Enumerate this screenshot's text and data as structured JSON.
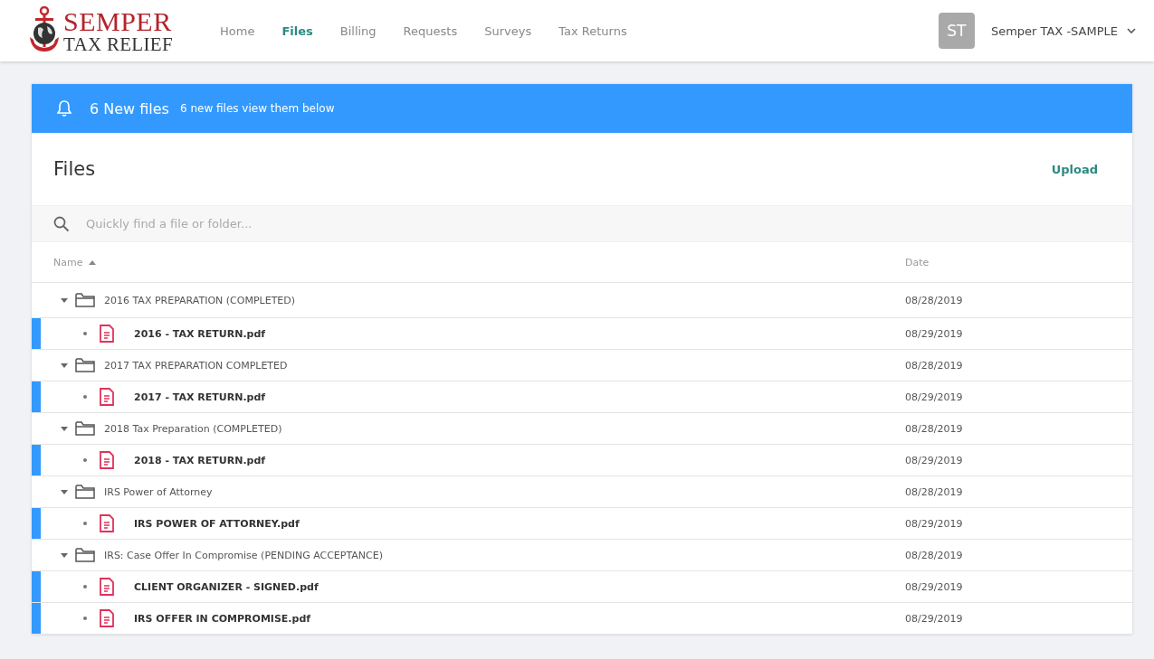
{
  "logo": {
    "line_1": "SEMPER",
    "line_2": "TAX RELIEF"
  },
  "nav": [
    {
      "label": "Home",
      "selected": false
    },
    {
      "label": "Files",
      "selected": true
    },
    {
      "label": "Billing",
      "selected": false
    },
    {
      "label": "Requests",
      "selected": false
    },
    {
      "label": "Surveys",
      "selected": false
    },
    {
      "label": "Tax Returns",
      "selected": false
    }
  ],
  "user": {
    "initials": "ST",
    "name": "Semper TAX -SAMPLE"
  },
  "banner": {
    "title": "6 New files",
    "message": "6 new files view them below"
  },
  "files": {
    "title": "Files",
    "upload": "Upload",
    "search": {
      "placeholder": "Quickly find a file or folder..."
    },
    "columns": [
      {
        "label": "Name",
        "sorted": true
      },
      {
        "label": "Date",
        "sorted": false
      }
    ],
    "tree": [
      {
        "name": "2016 TAX PREPARATION (COMPLETED)",
        "date": "08/28/2019",
        "expanded": true,
        "children": [
          {
            "name": "2016 - TAX RETURN.pdf",
            "date": "08/29/2019",
            "new": true
          }
        ]
      },
      {
        "name": "2017 TAX PREPARATION COMPLETED",
        "date": "08/28/2019",
        "expanded": true,
        "children": [
          {
            "name": "2017 - TAX RETURN.pdf",
            "date": "08/29/2019",
            "new": true
          }
        ]
      },
      {
        "name": "2018 Tax Preparation (COMPLETED)",
        "date": "08/28/2019",
        "expanded": true,
        "children": [
          {
            "name": "2018 - TAX RETURN.pdf",
            "date": "08/29/2019",
            "new": true
          }
        ]
      },
      {
        "name": "IRS Power of Attorney",
        "date": "08/28/2019",
        "expanded": true,
        "children": [
          {
            "name": "IRS POWER OF ATTORNEY.pdf",
            "date": "08/29/2019",
            "new": true
          }
        ]
      },
      {
        "name": "IRS: Case Offer In Compromise (PENDING ACCEPTANCE)",
        "date": "08/28/2019",
        "expanded": true,
        "children": [
          {
            "name": "CLIENT ORGANIZER - SIGNED.pdf",
            "date": "08/29/2019",
            "new": true
          },
          {
            "name": "IRS OFFER IN COMPROMISE.pdf",
            "date": "08/29/2019",
            "new": true
          }
        ]
      }
    ]
  }
}
